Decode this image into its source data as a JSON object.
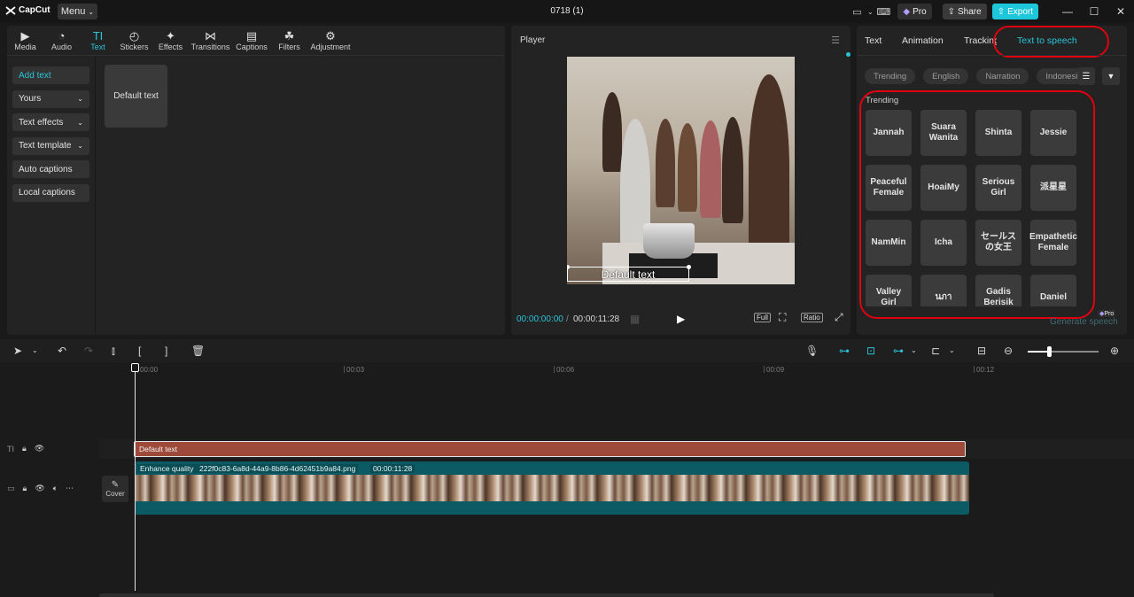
{
  "app": {
    "name": "CapCut",
    "menu_label": "Menu",
    "project_title": "0718 (1)",
    "pro_label": "Pro",
    "share_label": "Share",
    "export_label": "Export"
  },
  "tools": [
    {
      "label": "Media",
      "icon": "media-icon"
    },
    {
      "label": "Audio",
      "icon": "audio-icon"
    },
    {
      "label": "Text",
      "icon": "text-icon"
    },
    {
      "label": "Stickers",
      "icon": "stickers-icon"
    },
    {
      "label": "Effects",
      "icon": "effects-icon"
    },
    {
      "label": "Transitions",
      "icon": "transitions-icon"
    },
    {
      "label": "Captions",
      "icon": "captions-icon"
    },
    {
      "label": "Filters",
      "icon": "filters-icon"
    },
    {
      "label": "Adjustment",
      "icon": "adjustment-icon"
    }
  ],
  "sidenav": [
    {
      "label": "Add text"
    },
    {
      "label": "Yours"
    },
    {
      "label": "Text effects"
    },
    {
      "label": "Text template"
    },
    {
      "label": "Auto captions"
    },
    {
      "label": "Local captions"
    }
  ],
  "text_panel": {
    "default_card": "Default text"
  },
  "player": {
    "title": "Player",
    "caption": "Default text",
    "current_time": "00:00:00:00",
    "total_time": "00:00:11:28",
    "full_label": "Full",
    "ratio_label": "Ratio"
  },
  "right_panel": {
    "tabs": [
      "Text",
      "Animation",
      "Tracking",
      "Text to speech"
    ],
    "chips": [
      "Trending",
      "English",
      "Narration",
      "Indonesian"
    ],
    "trending_label": "Trending",
    "voices": [
      "Jannah",
      "Suara Wanita",
      "Shinta",
      "Jessie",
      "Peaceful Female",
      "HoaiMy",
      "Serious Girl",
      "派星星",
      "NamMin",
      "Icha",
      "セールスの女王",
      "Empathetic Female",
      "Valley Girl",
      "นภา",
      "Gadis Berisik",
      "Daniel"
    ],
    "generate_label": "Generate speech",
    "pro_tag": "Pro"
  },
  "timeline": {
    "ruler_labels": [
      "00:00",
      "00:03",
      "00:06",
      "00:09",
      "00:12"
    ],
    "text_clip_label": "Default text",
    "video_clip": {
      "tag": "Enhance quality",
      "filename": "222f0c83-6a8d-44a9-8b86-4d62451b9a84.png",
      "duration": "00:00:11:28"
    },
    "cover_label": "Cover"
  },
  "colors": {
    "accent": "#29c4d8",
    "export": "#1ec6d9",
    "text_clip": "#9e4a3b",
    "video_clip": "#0c5b64",
    "highlight": "#e1000f"
  }
}
